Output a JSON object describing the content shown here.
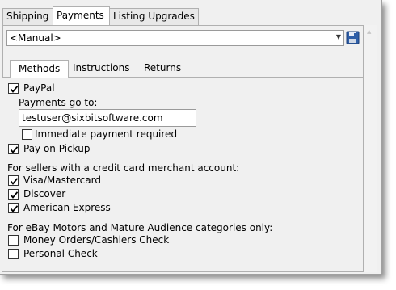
{
  "top_tabs": [
    "Shipping",
    "Payments",
    "Listing Upgrades"
  ],
  "active_top_tab": "Payments",
  "profile_select": {
    "value": "<Manual>"
  },
  "inner_tabs": [
    "Methods",
    "Instructions",
    "Returns"
  ],
  "active_inner_tab": "Methods",
  "methods": {
    "paypal": {
      "label": "PayPal",
      "checked": true
    },
    "payments_go_to_label": "Payments go to:",
    "paypal_email": "testuser@sixbitsoftware.com",
    "immediate_payment": {
      "label": "Immediate payment required",
      "checked": false
    },
    "pay_on_pickup": {
      "label": "Pay on Pickup",
      "checked": true
    },
    "merchant_heading": "For sellers with a credit card merchant account:",
    "visa_mastercard": {
      "label": "Visa/Mastercard",
      "checked": true
    },
    "discover": {
      "label": "Discover",
      "checked": true
    },
    "american_express": {
      "label": "American Express",
      "checked": true
    },
    "motors_heading": "For eBay Motors and Mature Audience categories only:",
    "money_orders": {
      "label": "Money Orders/Cashiers Check",
      "checked": false
    },
    "personal_check": {
      "label": "Personal Check",
      "checked": false
    }
  },
  "colors": {
    "check": "#000000",
    "save_icon": "#2f5fa8"
  }
}
